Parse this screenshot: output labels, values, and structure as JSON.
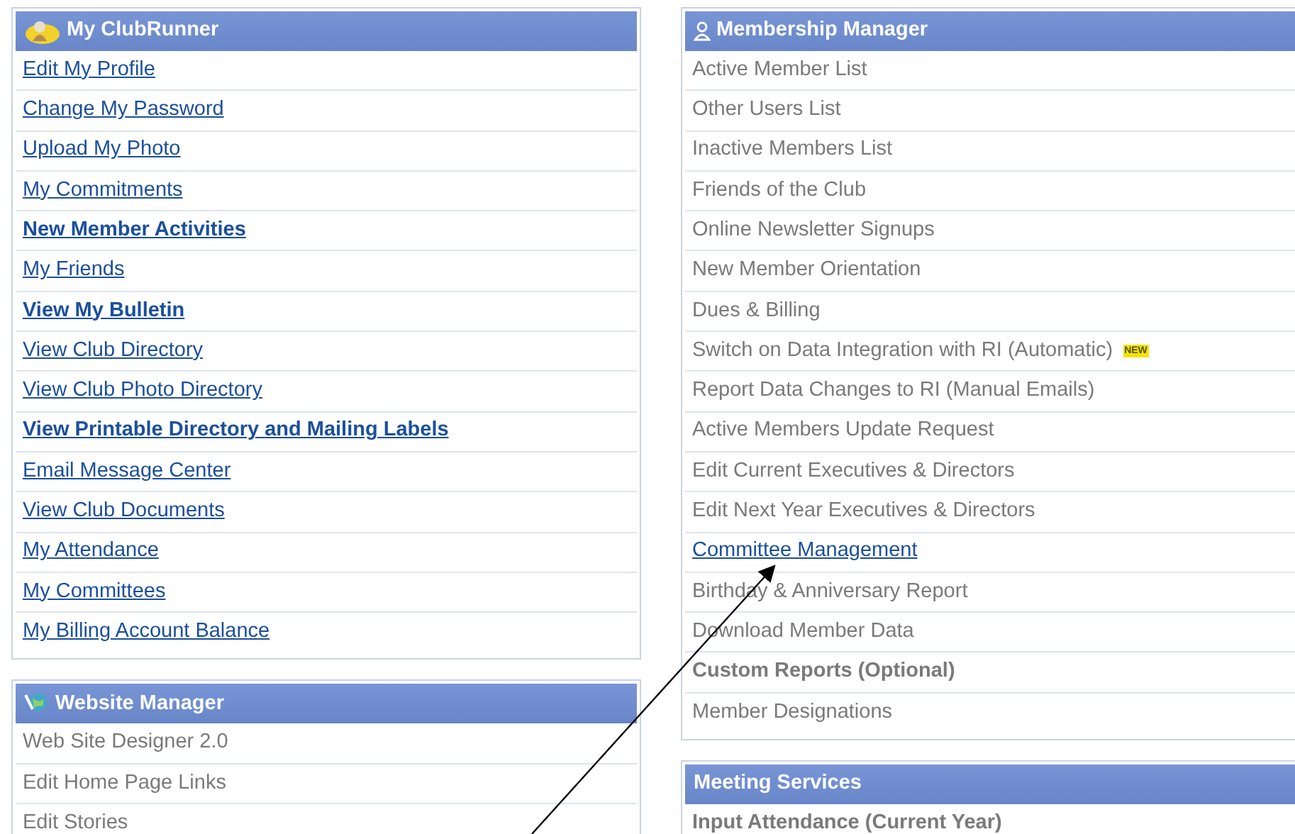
{
  "left_column": [
    {
      "title": "My ClubRunner",
      "items": [
        {
          "label": "Edit My Profile",
          "kind": "link",
          "bold": false
        },
        {
          "label": "Change My Password",
          "kind": "link",
          "bold": false
        },
        {
          "label": "Upload My Photo",
          "kind": "link",
          "bold": false
        },
        {
          "label": "My Commitments",
          "kind": "link",
          "bold": false
        },
        {
          "label": "New Member Activities",
          "kind": "link",
          "bold": true
        },
        {
          "label": "My Friends",
          "kind": "link",
          "bold": false
        },
        {
          "label": "View My Bulletin",
          "kind": "link",
          "bold": true
        },
        {
          "label": "View Club Directory",
          "kind": "link",
          "bold": false
        },
        {
          "label": "View Club Photo Directory",
          "kind": "link",
          "bold": false
        },
        {
          "label": "View Printable Directory and Mailing Labels",
          "kind": "link",
          "bold": true
        },
        {
          "label": "Email Message Center",
          "kind": "link",
          "bold": false
        },
        {
          "label": "View Club Documents",
          "kind": "link",
          "bold": false
        },
        {
          "label": "My Attendance",
          "kind": "link",
          "bold": false
        },
        {
          "label": "My Committees",
          "kind": "link",
          "bold": false
        },
        {
          "label": "My Billing Account Balance",
          "kind": "link",
          "bold": false
        }
      ]
    },
    {
      "title": "Website Manager",
      "items": [
        {
          "label": "Web Site Designer 2.0",
          "kind": "plain",
          "bold": false
        },
        {
          "label": "Edit Home Page Links",
          "kind": "plain",
          "bold": false
        },
        {
          "label": "Edit Stories",
          "kind": "plain",
          "bold": false
        }
      ]
    }
  ],
  "right_column": [
    {
      "title": "Membership Manager",
      "items": [
        {
          "label": "Active Member List",
          "kind": "plain",
          "bold": false
        },
        {
          "label": "Other Users List",
          "kind": "plain",
          "bold": false
        },
        {
          "label": "Inactive Members List",
          "kind": "plain",
          "bold": false
        },
        {
          "label": "Friends of the Club",
          "kind": "plain",
          "bold": false
        },
        {
          "label": "Online Newsletter Signups",
          "kind": "plain",
          "bold": false
        },
        {
          "label": "New Member Orientation",
          "kind": "plain",
          "bold": false
        },
        {
          "label": "Dues & Billing",
          "kind": "plain",
          "bold": false
        },
        {
          "label": "Switch on Data Integration with RI (Automatic)",
          "kind": "plain",
          "bold": false,
          "badge": "NEW"
        },
        {
          "label": "Report Data Changes to RI (Manual Emails)",
          "kind": "plain",
          "bold": false
        },
        {
          "label": "Active Members Update Request",
          "kind": "plain",
          "bold": false
        },
        {
          "label": "Edit Current Executives & Directors",
          "kind": "plain",
          "bold": false
        },
        {
          "label": "Edit Next Year Executives & Directors",
          "kind": "plain",
          "bold": false
        },
        {
          "label": "Committee Management",
          "kind": "link",
          "bold": false
        },
        {
          "label": "Birthday & Anniversary Report",
          "kind": "plain",
          "bold": false
        },
        {
          "label": "Download Member Data",
          "kind": "plain",
          "bold": false
        },
        {
          "label": "Custom Reports (Optional)",
          "kind": "plain",
          "bold": true
        },
        {
          "label": "Member Designations",
          "kind": "plain",
          "bold": false
        }
      ]
    },
    {
      "title": "Meeting Services",
      "items": [
        {
          "label": "Input Attendance (Current Year)",
          "kind": "plain",
          "bold": true
        }
      ]
    }
  ]
}
